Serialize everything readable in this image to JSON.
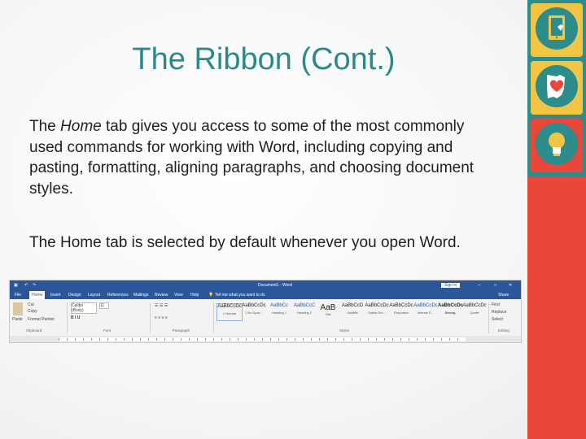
{
  "slide": {
    "title": "The Ribbon (Cont.)",
    "p1_pre": "The ",
    "p1_em": "Home",
    "p1_post": " tab gives you access to some of the most commonly used commands for working with Word, including copying and pasting, formatting, aligning paragraphs, and choosing document styles.",
    "p2": "The Home tab is selected by default whenever you open Word."
  },
  "sidebar": {
    "icons": [
      "tablet-touch-icon",
      "ohio-heart-icon",
      "lightbulb-icon"
    ],
    "colors": {
      "teal": "#2d8c8c",
      "red": "#e9473a",
      "yellow": "#f4c542"
    }
  },
  "ribbon": {
    "doc_title": "Document1 - Word",
    "sign_in": "Sign in",
    "tabs": [
      "File",
      "Home",
      "Insert",
      "Design",
      "Layout",
      "References",
      "Mailings",
      "Review",
      "View",
      "Help"
    ],
    "tell_me": "Tell me what you want to do",
    "share": "Share",
    "clipboard": {
      "paste": "Paste",
      "cut": "Cut",
      "copy": "Copy",
      "format_painter": "Format Painter",
      "label": "Clipboard"
    },
    "font": {
      "name": "Calibri (Body)",
      "size": "11",
      "label": "Font"
    },
    "paragraph_label": "Paragraph",
    "styles_label": "Styles",
    "styles": [
      {
        "sample": "AaBbCcDc",
        "name": "1 Normal"
      },
      {
        "sample": "AaBbCcDc",
        "name": "1 No Spac..."
      },
      {
        "sample": "AaBbCc",
        "name": "Heading 1"
      },
      {
        "sample": "AaBbCcC",
        "name": "Heading 2"
      },
      {
        "sample": "AaB",
        "name": "Title"
      },
      {
        "sample": "AaBbCcD",
        "name": "Subtitle"
      },
      {
        "sample": "AaBbCcDc",
        "name": "Subtle Em..."
      },
      {
        "sample": "AaBbCcDc",
        "name": "Emphasis"
      },
      {
        "sample": "AaBbCcDc",
        "name": "Intense E..."
      },
      {
        "sample": "AaBbCcDc",
        "name": "Strong"
      },
      {
        "sample": "AaBbCcDc",
        "name": "Quote"
      }
    ],
    "editing": {
      "find": "Find",
      "replace": "Replace",
      "select": "Select",
      "label": "Editing"
    },
    "colors": {
      "blue": "#2b579a"
    }
  }
}
